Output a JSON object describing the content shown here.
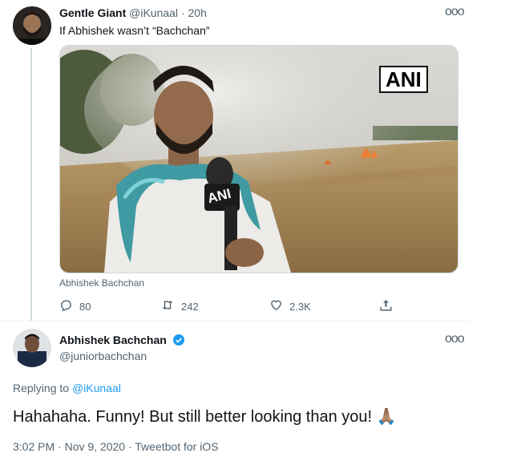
{
  "parent_tweet": {
    "display_name": "Gentle Giant",
    "handle": "@iKunaal",
    "separator": "·",
    "time": "20h",
    "text": "If Abhishek wasn’t “Bachchan”",
    "media_watermark": "ANI",
    "mic_flag": "ANI",
    "media_caption": "Abhishek Bachchan",
    "replies": "80",
    "retweets": "242",
    "likes": "2.3K",
    "more_icon": "more-icon"
  },
  "reply_tweet": {
    "display_name": "Abhishek Bachchan",
    "handle": "@juniorbachchan",
    "replying_prefix": "Replying to",
    "replying_to": "@iKunaal",
    "text": "Hahahaha. Funny! But still better looking than you!",
    "emoji": "🙏🏽",
    "meta": "3:02 PM · Nov 9, 2020 · Tweetbot for iOS"
  },
  "colors": {
    "accent": "#1d9bf0",
    "muted": "#536471"
  }
}
